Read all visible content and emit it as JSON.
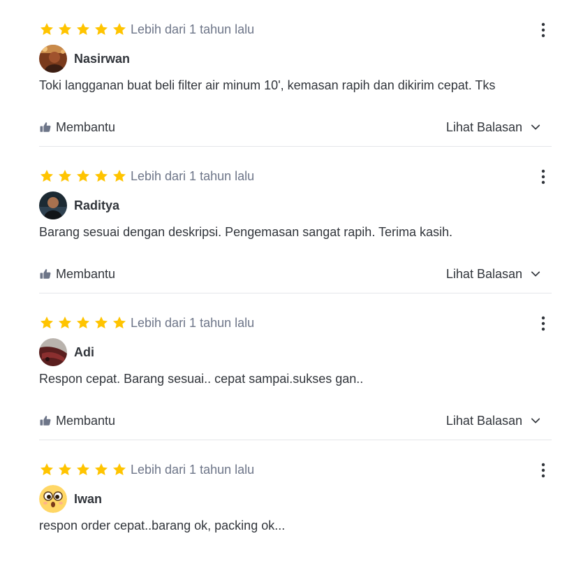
{
  "colors": {
    "star": "#ffc400",
    "text": "#31353b",
    "muted": "#6d7588",
    "divider": "#e4e6ea"
  },
  "reviews": [
    {
      "rating": 5,
      "time": "Lebih dari 1 tahun lalu",
      "user": "Nasirwan",
      "text": "Toki langganan buat beli filter air minum 10', kemasan rapih dan dikirim cepat. Tks",
      "helpful_label": "Membantu",
      "replies_label": "Lihat Balasan"
    },
    {
      "rating": 5,
      "time": "Lebih dari 1 tahun lalu",
      "user": "Raditya",
      "text": "Barang sesuai dengan deskripsi. Pengemasan sangat rapih. Terima kasih.",
      "helpful_label": "Membantu",
      "replies_label": "Lihat Balasan"
    },
    {
      "rating": 5,
      "time": "Lebih dari 1 tahun lalu",
      "user": "Adi",
      "text": "Respon cepat. Barang sesuai.. cepat sampai.sukses gan..",
      "helpful_label": "Membantu",
      "replies_label": "Lihat Balasan"
    },
    {
      "rating": 5,
      "time": "Lebih dari 1 tahun lalu",
      "user": "Iwan",
      "text": "respon order cepat..barang ok, packing ok...",
      "helpful_label": "",
      "replies_label": ""
    }
  ]
}
